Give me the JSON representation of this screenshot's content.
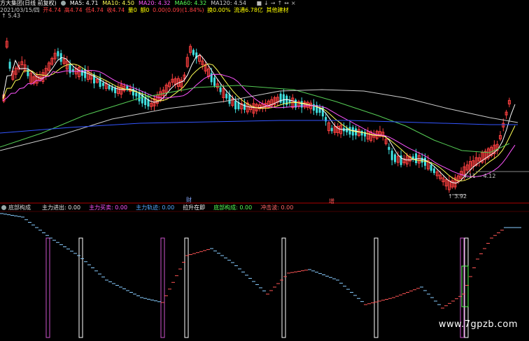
{
  "header": {
    "title": "方大集团(日线 前复权)",
    "ma": [
      {
        "label": "MA5: 4.71",
        "color": "#ffffff"
      },
      {
        "label": "MA10: 4.50",
        "color": "#ffff55"
      },
      {
        "label": "MA20: 4.32",
        "color": "#ff55ff"
      },
      {
        "label": "MA60: 4.32",
        "color": "#55ff55"
      },
      {
        "label": "MA120: 4.54",
        "color": "#cccccc"
      }
    ],
    "icons": [
      "■",
      "↓",
      "→",
      "↑",
      "↔",
      "×"
    ]
  },
  "info": {
    "date": "2021/03/15/四",
    "open": "开4.74",
    "high": "高4.74",
    "low": "低4.74",
    "close": "收4.74",
    "vol": "量0",
    "amount": "额0",
    "change": "0.00(0.09)(1.84%)",
    "turnover": "换0.00%",
    "float": "流通6.78亿",
    "concept": "其他建材"
  },
  "price_labels": {
    "high": "5.43",
    "recent_high": "4.11 -- 4.12",
    "low": "3.92",
    "event1": "财",
    "event2": "增"
  },
  "indicator": {
    "name": "底部构成",
    "items": [
      {
        "label": "主力进出: 0.00",
        "color": "#e6e6e6"
      },
      {
        "label": "主力买卖: 0.00",
        "color": "#ff55ff"
      },
      {
        "label": "主力轨迹: 0.00",
        "color": "#55aaff"
      },
      {
        "label": "拉升在即",
        "color": "#ffffff"
      },
      {
        "label": "底部构成: 0.00",
        "color": "#55ff55"
      },
      {
        "label": "冲击波: 0.00",
        "color": "#ff6666"
      }
    ]
  },
  "colors": {
    "up": "#ff4040",
    "down": "#40e0e0",
    "ma5": "#ffffff",
    "ma10": "#ffff55",
    "ma20": "#ff55ff",
    "ma60": "#55cc55",
    "ma120": "#cccccc",
    "blue_line": "#3355ff"
  },
  "watermark": "www.7gpzb.com"
}
